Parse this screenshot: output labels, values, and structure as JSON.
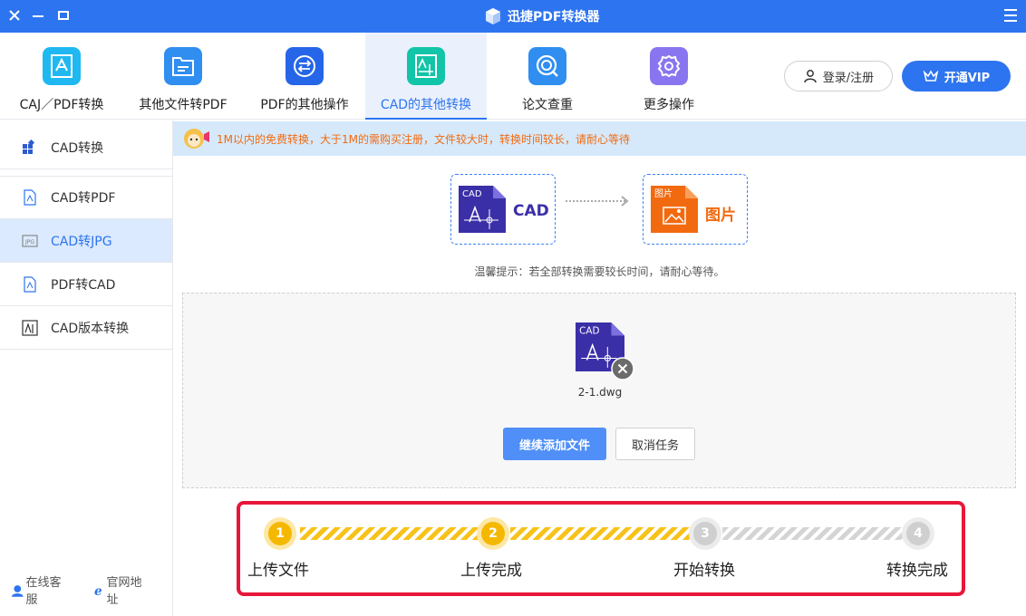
{
  "app": {
    "title": "迅捷PDF转换器"
  },
  "toolbar": {
    "tabs": [
      {
        "label": "CAJ／PDF转换",
        "color": "#1fb8f0"
      },
      {
        "label": "其他文件转PDF",
        "color": "#2f8ef0"
      },
      {
        "label": "PDF的其他操作",
        "color": "#2566e8"
      },
      {
        "label": "CAD的其他转换",
        "color": "#12c4a8"
      },
      {
        "label": "论文查重",
        "color": "#2f8ef0"
      },
      {
        "label": "更多操作",
        "color": "#8a75f0"
      }
    ],
    "active_tab": "CAD的其他转换",
    "login_label": "登录/注册",
    "vip_label": "开通VIP"
  },
  "sidebar": {
    "items": [
      {
        "label": "CAD转换"
      },
      {
        "label": "CAD转PDF"
      },
      {
        "label": "CAD转JPG"
      },
      {
        "label": "PDF转CAD"
      },
      {
        "label": "CAD版本转换"
      }
    ],
    "active_item": "CAD转JPG",
    "footer": {
      "service": "在线客服",
      "website": "官网地址"
    }
  },
  "notice": {
    "text": "1M以内的免费转换，大于1M的需购买注册，文件较大时，转换时间较长，请耐心等待"
  },
  "conversion": {
    "from_tag": "CAD",
    "from_label": "CAD",
    "to_tag": "图片",
    "to_label": "图片",
    "from_color": "#3b2fa8",
    "to_color": "#f26a0f"
  },
  "hint": "温馨提示：若全部转换需要较长时间，请耐心等待。",
  "file": {
    "name": "2-1.dwg",
    "tag": "CAD"
  },
  "actions": {
    "add_label": "继续添加文件",
    "cancel_label": "取消任务"
  },
  "steps": {
    "items": [
      {
        "num": "1",
        "label": "上传文件",
        "done": true
      },
      {
        "num": "2",
        "label": "上传完成",
        "done": true
      },
      {
        "num": "3",
        "label": "开始转换",
        "done": false
      },
      {
        "num": "4",
        "label": "转换完成",
        "done": false
      }
    ]
  }
}
